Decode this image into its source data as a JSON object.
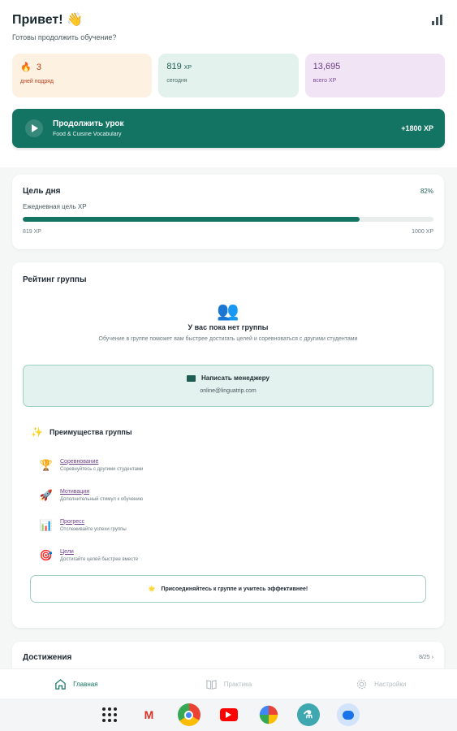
{
  "header": {
    "greeting": "Привет! 👋",
    "subtitle": "Готовы продолжить обучение?"
  },
  "stats": [
    {
      "icon": "fire-icon",
      "value": "3",
      "label": "дней подряд"
    },
    {
      "value": "819",
      "unit": "XP",
      "label": "сегодня"
    },
    {
      "value": "13,695",
      "label": "всего XP"
    }
  ],
  "continue_lesson": {
    "title": "Продолжить урок",
    "subtitle": "Food & Cuisine Vocabulary",
    "xp": "+1800 XP"
  },
  "daily_goal": {
    "title": "Цель дня",
    "percent_text": "82%",
    "progress": 0.82,
    "label": "Ежедневная цель XP",
    "current": "819 XP",
    "target": "1000 XP"
  },
  "group_rating": {
    "title": "Рейтинг группы",
    "empty_title": "У вас пока нет группы",
    "empty_desc": "Обучение в группе поможет вам быстрее достигать целей и соревноваться с другими студентами",
    "manager_button": "Написать менеджеру",
    "manager_email": "online@linguatrip.com",
    "advantages_title": "Преимущества группы",
    "advantages": [
      {
        "icon": "🏆",
        "name": "Соревнование",
        "desc": "Соревнуйтесь с другими студентами"
      },
      {
        "icon": "🚀",
        "name": "Мотивация",
        "desc": "Дополнительный стимул к обучению"
      },
      {
        "icon": "📊",
        "name": "Прогресс",
        "desc": "Отслеживайте успехи группы"
      },
      {
        "icon": "🎯",
        "name": "Цели",
        "desc": "Достигайте целей быстрее вместе"
      }
    ],
    "join_label": "Присоединяйтесь к группе и учитесь эффективнее!"
  },
  "achievements": {
    "title": "Достижения",
    "count": "8/25"
  },
  "nav": [
    {
      "label": "Главная",
      "active": true
    },
    {
      "label": "Практика",
      "active": false
    },
    {
      "label": "Настройки",
      "active": false
    }
  ],
  "colors": {
    "primary": "#137463",
    "streak": "#c0421e",
    "purple": "#6a3d85"
  }
}
